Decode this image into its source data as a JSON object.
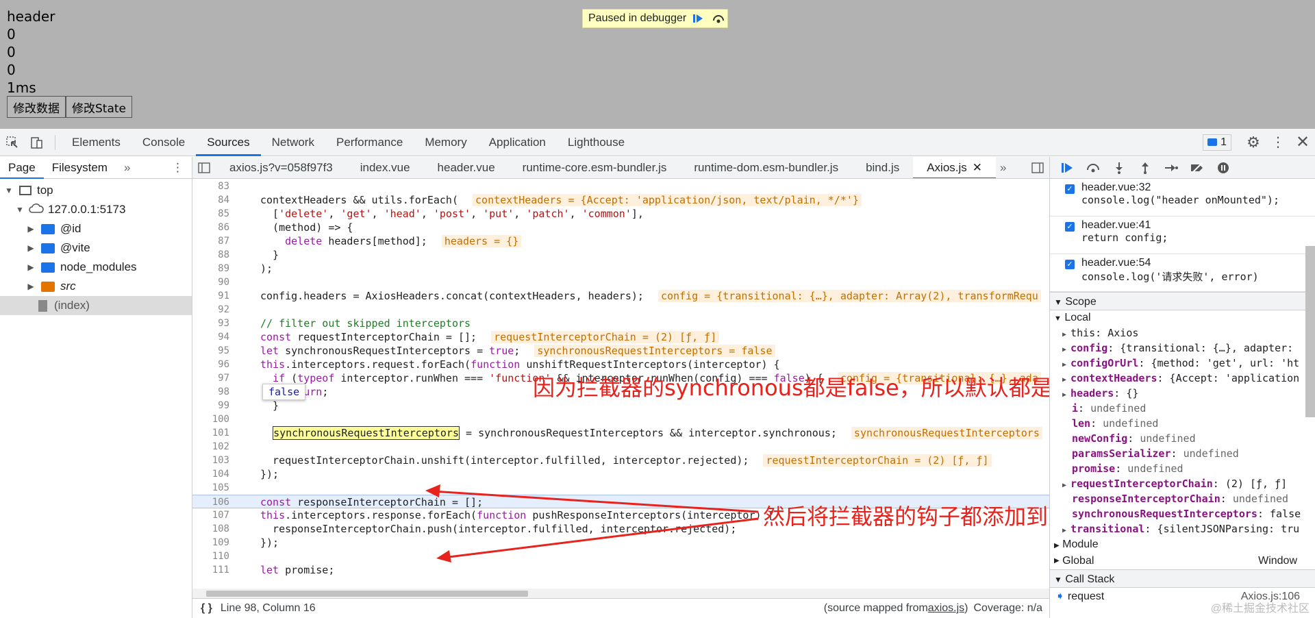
{
  "app": {
    "lines": [
      "header",
      "0",
      "0",
      "0",
      "1ms"
    ],
    "buttons": [
      "修改数据",
      "修改State"
    ],
    "paused_label": "Paused in debugger"
  },
  "devtools": {
    "tabs": [
      "Elements",
      "Console",
      "Sources",
      "Network",
      "Performance",
      "Memory",
      "Application",
      "Lighthouse"
    ],
    "active_tab": "Sources",
    "issues_count": "1",
    "left_panel": {
      "tabs": [
        "Page",
        "Filesystem"
      ],
      "tree": [
        {
          "label": "top",
          "type": "frame",
          "depth": 0
        },
        {
          "label": "127.0.0.1:5173",
          "type": "cloud",
          "depth": 1
        },
        {
          "label": "@id",
          "type": "folder",
          "depth": 2
        },
        {
          "label": "@vite",
          "type": "folder",
          "depth": 2
        },
        {
          "label": "node_modules",
          "type": "folder",
          "depth": 2
        },
        {
          "label": "src",
          "type": "folder-orange",
          "depth": 2
        },
        {
          "label": "(index)",
          "type": "file",
          "depth": 2
        }
      ]
    },
    "file_tabs": [
      "axios.js?v=058f97f3",
      "index.vue",
      "header.vue",
      "runtime-core.esm-bundler.js",
      "runtime-dom.esm-bundler.js",
      "bind.js",
      "Axios.js"
    ],
    "active_file": "Axios.js",
    "code_lines": [
      {
        "n": "83",
        "html": ""
      },
      {
        "n": "84",
        "html": "contextHeaders &amp;&amp; utils.forEach( <span class='iv'>contextHeaders = {Accept: 'application/json, text/plain, */*'}</span>"
      },
      {
        "n": "85",
        "html": "  [<span class='str'>'delete'</span>, <span class='str'>'get'</span>, <span class='str'>'head'</span>, <span class='str'>'post'</span>, <span class='str'>'put'</span>, <span class='str'>'patch'</span>, <span class='str'>'common'</span>],"
      },
      {
        "n": "86",
        "html": "  (method) =&gt; {"
      },
      {
        "n": "87",
        "html": "    <span class='kw'>delete</span> headers[method]; <span class='iv'>headers = {}</span>"
      },
      {
        "n": "88",
        "html": "  }"
      },
      {
        "n": "89",
        "html": ");"
      },
      {
        "n": "90",
        "html": ""
      },
      {
        "n": "91",
        "html": "config.headers = AxiosHeaders.concat(contextHeaders, headers); <span class='iv'>config = {transitional: {…}, adapter: Array(2), transformRequ</span>"
      },
      {
        "n": "92",
        "html": ""
      },
      {
        "n": "93",
        "html": "<span class='cm'>// filter out skipped interceptors</span>"
      },
      {
        "n": "94",
        "html": "<span class='kw'>const</span> requestInterceptorChain = []; <span class='iv'>requestInterceptorChain = (2) [ƒ, ƒ]</span>"
      },
      {
        "n": "95",
        "html": "<span class='kw'>let</span> synchronousRequestInterceptors = <span class='kw'>true</span>; <span class='iv'>synchronousRequestInterceptors = false</span>"
      },
      {
        "n": "96",
        "html": "<span class='kw'>this</span>.interceptors.request.forEach(<span class='kw'>function</span> unshiftRequestInterceptors(interceptor) {"
      },
      {
        "n": "97",
        "html": "  <span class='kw'>if</span> (<span class='kw'>typeof</span> interceptor.runWhen === <span class='str'>'function'</span> &amp;&amp; interceptor.runWhen(config) === <span class='kw'>false</span>) { <span class='iv'>config = {transitional: {…}, ada</span>"
      },
      {
        "n": "98",
        "html": "    <span class='kw'>return</span>;"
      },
      {
        "n": "99",
        "html": "  }"
      },
      {
        "n": "100",
        "html": ""
      },
      {
        "n": "101",
        "html": "  <span class='hl'>synchronousRequestInterceptors</span> = synchronousRequestInterceptors &amp;&amp; interceptor.synchronous; <span class='iv'>synchronousRequestInterceptors</span>"
      },
      {
        "n": "102",
        "html": ""
      },
      {
        "n": "103",
        "html": "  requestInterceptorChain.unshift(interceptor.fulfilled, interceptor.rejected); <span class='iv'>requestInterceptorChain = (2) [ƒ, ƒ]</span>"
      },
      {
        "n": "104",
        "html": "});"
      },
      {
        "n": "105",
        "html": ""
      },
      {
        "n": "106",
        "html": "<span class='kw'>const</span> responseInterceptorChain = [];",
        "cur": true
      },
      {
        "n": "107",
        "html": "<span class='kw'>this</span>.interceptors.response.forEach(<span class='kw'>function</span> pushResponseInterceptors(interceptor) {"
      },
      {
        "n": "108",
        "html": "  responseInterceptorChain.push(interceptor.fulfilled, interceptor.rejected);"
      },
      {
        "n": "109",
        "html": "});"
      },
      {
        "n": "110",
        "html": ""
      },
      {
        "n": "111",
        "html": "<span class='kw'>let</span> promise;"
      }
    ],
    "tooltip": "false",
    "annotations": [
      "因为拦截器的synchronous都是false，所以默认都是异步执行",
      "然后将拦截器的钩子都添加到对应的执行链中"
    ],
    "status": {
      "position": "Line 98, Column 16",
      "source_mapped_prefix": "(source mapped from ",
      "source_mapped_link": "axios.js",
      "source_mapped_suffix": ")",
      "coverage": "Coverage: n/a"
    },
    "breakpoints": [
      {
        "loc": "header.vue:32",
        "src": "console.log(\"header onMounted\");"
      },
      {
        "loc": "header.vue:41",
        "src": "return config;"
      },
      {
        "loc": "header.vue:54",
        "src": "console.log('请求失败', error)"
      }
    ],
    "scope_title": "Scope",
    "local_title": "Local",
    "scope_items": [
      {
        "k": "this",
        "v": "Axios",
        "exp": true,
        "plain": true
      },
      {
        "k": "config",
        "v": "{transitional: {…}, adapter:",
        "exp": true
      },
      {
        "k": "configOrUrl",
        "v": "{method: 'get', url: 'ht",
        "exp": true
      },
      {
        "k": "contextHeaders",
        "v": "{Accept: 'application",
        "exp": true
      },
      {
        "k": "headers",
        "v": "{}",
        "exp": true
      },
      {
        "k": "i",
        "v": "undefined",
        "exp": false
      },
      {
        "k": "len",
        "v": "undefined",
        "exp": false
      },
      {
        "k": "newConfig",
        "v": "undefined",
        "exp": false
      },
      {
        "k": "paramsSerializer",
        "v": "undefined",
        "exp": false
      },
      {
        "k": "promise",
        "v": "undefined",
        "exp": false
      },
      {
        "k": "requestInterceptorChain",
        "v": "(2) [ƒ, ƒ]",
        "exp": true
      },
      {
        "k": "responseInterceptorChain",
        "v": "undefined",
        "exp": false
      },
      {
        "k": "synchronousRequestInterceptors",
        "v": "false",
        "exp": false
      },
      {
        "k": "transitional",
        "v": "{silentJSONParsing: tru",
        "exp": true
      }
    ],
    "module_label": "Module",
    "global_label": "Global",
    "global_value": "Window",
    "callstack_title": "Call Stack",
    "callstack_fn": "request",
    "callstack_loc": "Axios.js:106",
    "watermark": "@稀土掘金技术社区"
  }
}
